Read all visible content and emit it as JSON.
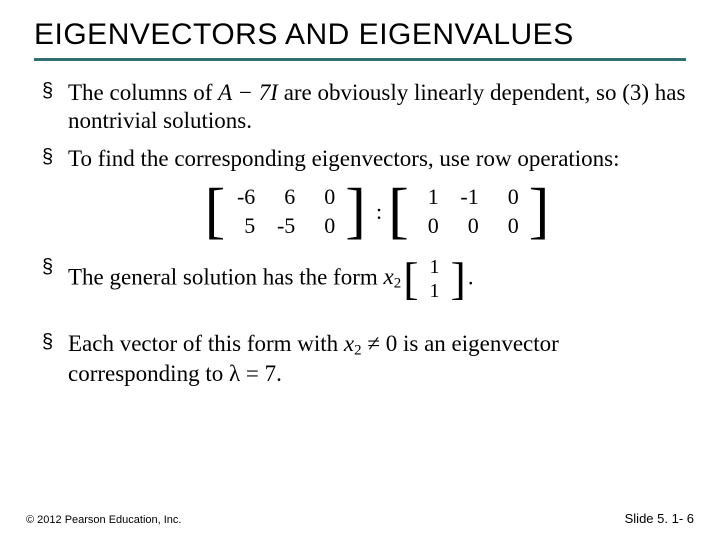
{
  "title": "EIGENVECTORS AND EIGENVALUES",
  "bullets": {
    "b1a": "The columns of ",
    "b1_expr": "A − 7I",
    "b1b": " are obviously linearly dependent, so (3) has nontrivial solutions.",
    "b2": "To find the corresponding eigenvectors, use row operations:",
    "b3a": "The general solution has the form ",
    "b3_x2": "x",
    "b3_sub": "2",
    "b3_dot": ".",
    "b4a": "Each vector of this form with ",
    "b4_expr": "x",
    "b4_sub": "2",
    "b4_neq": " ≠ 0",
    "b4b": " is an eigenvector corresponding to ",
    "b4_lambda": "λ = 7",
    "b4_dot": "."
  },
  "chart_data": {
    "type": "table",
    "matrices": {
      "left": [
        [
          -6,
          6,
          0
        ],
        [
          5,
          -5,
          0
        ]
      ],
      "right": [
        [
          1,
          -1,
          0
        ],
        [
          0,
          0,
          0
        ]
      ],
      "solution_vector": [
        [
          1
        ],
        [
          1
        ]
      ]
    }
  },
  "footer": {
    "left": "© 2012 Pearson Education, Inc.",
    "right": "Slide 5. 1- 6"
  }
}
